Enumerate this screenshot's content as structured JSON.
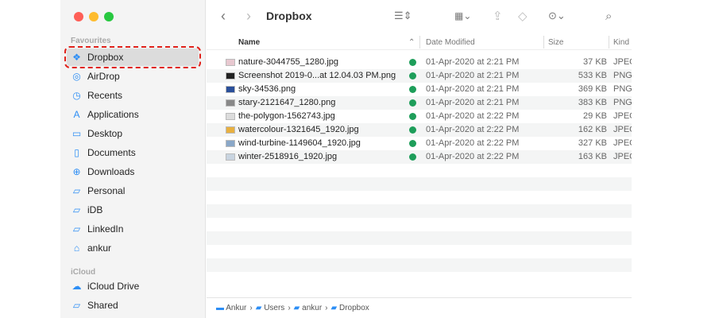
{
  "window": {
    "title": "Dropbox"
  },
  "sidebar": {
    "favourites_label": "Favourites",
    "icloud_label": "iCloud",
    "items": [
      {
        "label": "Dropbox",
        "icon": "dropbox-icon"
      },
      {
        "label": "AirDrop",
        "icon": "airdrop-icon"
      },
      {
        "label": "Recents",
        "icon": "clock-icon"
      },
      {
        "label": "Applications",
        "icon": "applications-icon"
      },
      {
        "label": "Desktop",
        "icon": "desktop-icon"
      },
      {
        "label": "Documents",
        "icon": "document-icon"
      },
      {
        "label": "Downloads",
        "icon": "download-icon"
      },
      {
        "label": "Personal",
        "icon": "folder-icon"
      },
      {
        "label": "iDB",
        "icon": "folder-icon"
      },
      {
        "label": "LinkedIn",
        "icon": "folder-icon"
      },
      {
        "label": "ankur",
        "icon": "home-icon"
      }
    ],
    "icloud_items": [
      {
        "label": "iCloud Drive",
        "icon": "cloud-icon"
      },
      {
        "label": "Shared",
        "icon": "shared-folder-icon"
      }
    ]
  },
  "columns": {
    "name": "Name",
    "date": "Date Modified",
    "size": "Size",
    "kind": "Kind"
  },
  "files": [
    {
      "name": "nature-3044755_1280.jpg",
      "date": "01-Apr-2020 at 2:21 PM",
      "size": "37 KB",
      "kind": "JPEG",
      "thumb": "#e8c8d0"
    },
    {
      "name": "Screenshot 2019-0...at 12.04.03 PM.png",
      "date": "01-Apr-2020 at 2:21 PM",
      "size": "533 KB",
      "kind": "PNG",
      "thumb": "#222222"
    },
    {
      "name": "sky-34536.png",
      "date": "01-Apr-2020 at 2:21 PM",
      "size": "369 KB",
      "kind": "PNG",
      "thumb": "#2a4f9a"
    },
    {
      "name": "stary-2121647_1280.png",
      "date": "01-Apr-2020 at 2:21 PM",
      "size": "383 KB",
      "kind": "PNG",
      "thumb": "#888888"
    },
    {
      "name": "the-polygon-1562743.jpg",
      "date": "01-Apr-2020 at 2:22 PM",
      "size": "29 KB",
      "kind": "JPEG",
      "thumb": "#dddddd"
    },
    {
      "name": "watercolour-1321645_1920.jpg",
      "date": "01-Apr-2020 at 2:22 PM",
      "size": "162 KB",
      "kind": "JPEG",
      "thumb": "#e8b040"
    },
    {
      "name": "wind-turbine-1149604_1920.jpg",
      "date": "01-Apr-2020 at 2:22 PM",
      "size": "327 KB",
      "kind": "JPEG",
      "thumb": "#8aa8c8"
    },
    {
      "name": "winter-2518916_1920.jpg",
      "date": "01-Apr-2020 at 2:22 PM",
      "size": "163 KB",
      "kind": "JPEG",
      "thumb": "#c8d4e0"
    }
  ],
  "pathbar": [
    "Ankur",
    "Users",
    "ankur",
    "Dropbox"
  ]
}
